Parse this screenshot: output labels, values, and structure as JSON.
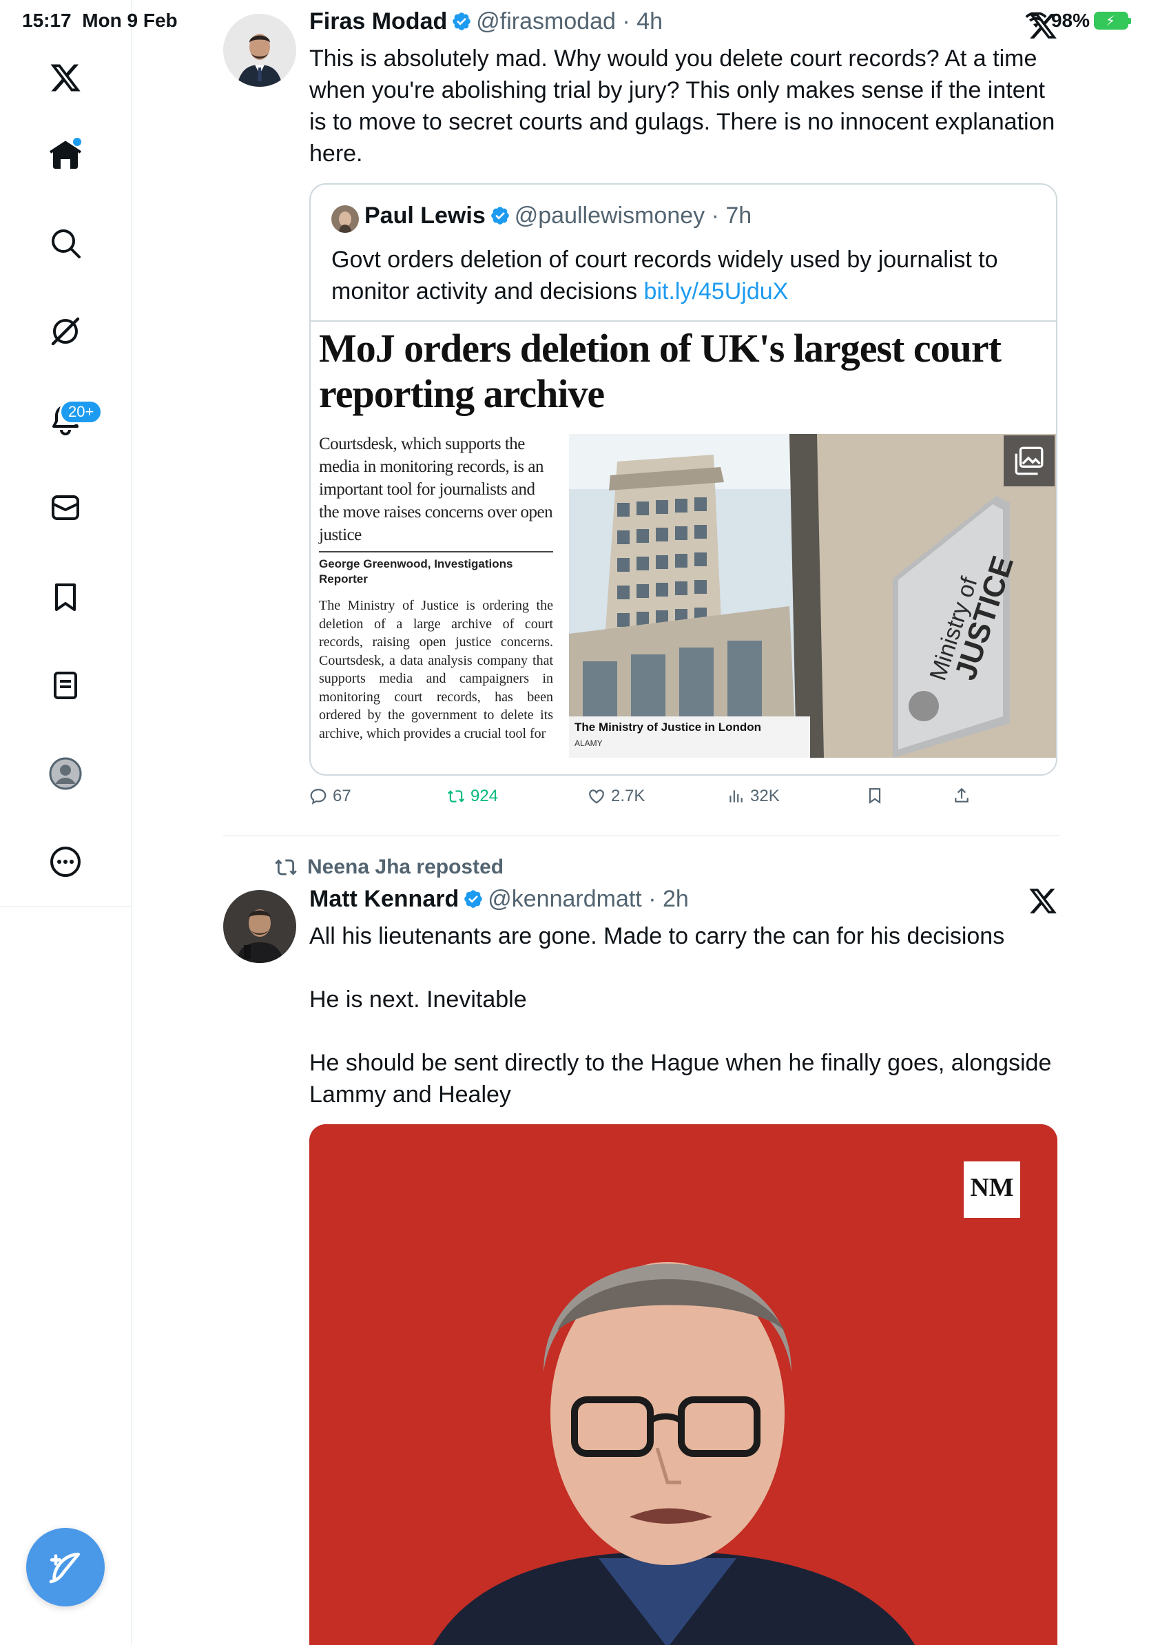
{
  "status_bar": {
    "time": "15:17",
    "date": "Mon 9 Feb",
    "battery": "98%"
  },
  "sidebar": {
    "items": [
      {
        "name": "x-logo"
      },
      {
        "name": "home"
      },
      {
        "name": "explore"
      },
      {
        "name": "grok"
      },
      {
        "name": "notifications",
        "badge": "20+"
      },
      {
        "name": "messages"
      },
      {
        "name": "bookmarks"
      },
      {
        "name": "lists"
      },
      {
        "name": "profile"
      },
      {
        "name": "more"
      }
    ]
  },
  "tweets": [
    {
      "author_name": "Firas Modad",
      "handle": "@firasmodad",
      "time": "4h",
      "text_lines": [
        "This is absolutely mad. Why would you delete court records? At a time",
        "when you're abolishing trial by jury? This only makes sense if the intent",
        "is to move to secret courts and gulags. There is no innocent explanation",
        "here."
      ],
      "quote": {
        "author_name": "Paul Lewis",
        "handle": "@paullewismoney",
        "time": "7h",
        "text_line1": "Govt orders deletion of court records widely used by journalist to",
        "text_line2": "monitor activity and decisions ",
        "link": "bit.ly/45UjduX",
        "article": {
          "headline_line1": "MoJ orders deletion of UK's largest court",
          "headline_line2": "reporting archive",
          "lede": "Courtsdesk, which supports the media in monitoring records, is an important tool for journalists and the move raises concerns over open justice",
          "byline": "George Greenwood, Investigations Reporter",
          "body": "The Ministry of Justice is ordering the deletion of a large archive of court records, raising open justice concerns. Courtsdesk, a data analysis company that supports media and campaigners in monitoring court records, has been ordered by the government to delete its archive, which provides a crucial tool for",
          "photo_caption": "The Ministry of Justice in London",
          "photo_credit": "ALAMY",
          "sign_line1": "Ministry of",
          "sign_line2": "JUSTICE"
        }
      },
      "actions": {
        "replies": "67",
        "reposts": "924",
        "likes": "2.7K",
        "views": "32K"
      }
    },
    {
      "reposted_by": "Neena Jha reposted",
      "author_name": "Matt Kennard",
      "handle": "@kennardmatt",
      "time": "2h",
      "text_lines": [
        "All his lieutenants are gone. Made to carry the can for his decisions",
        "",
        "He is next. Inevitable",
        "",
        "He should be sent directly to the Hague when he finally goes, alongside",
        "Lammy and Healey"
      ],
      "media_logo": "NM"
    }
  ],
  "colors": {
    "accent": "#1d9bf0",
    "repost_green": "#00ba7c",
    "secondary_text": "#536471",
    "media_red": "#c42e25"
  }
}
